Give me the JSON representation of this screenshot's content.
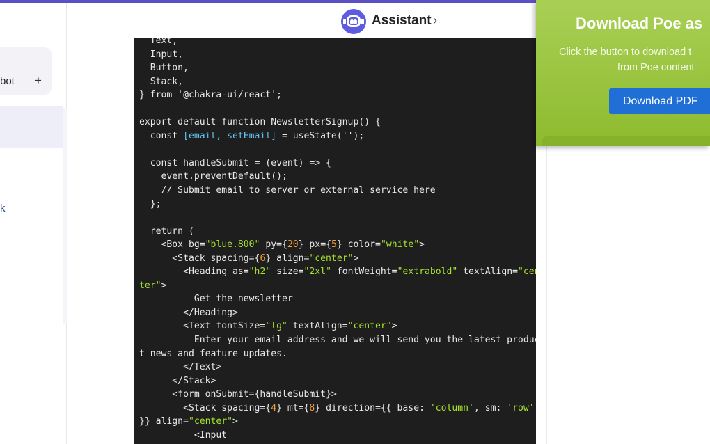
{
  "sidebar": {
    "new_chat_label": "bot",
    "plus_symbol": "+",
    "link_fragment": "k"
  },
  "header": {
    "bot_name": "Assistant",
    "chevron": "›"
  },
  "code_block": {
    "lines": [
      [
        {
          "t": "  Text,"
        }
      ],
      [
        {
          "t": "  Input,"
        }
      ],
      [
        {
          "t": "  Button,"
        }
      ],
      [
        {
          "t": "  Stack,"
        }
      ],
      [
        {
          "t": "} from '@chakra-ui/react';"
        }
      ],
      [
        {
          "t": ""
        }
      ],
      [
        {
          "t": "export default function NewsletterSignup() {"
        }
      ],
      [
        {
          "t": "  const "
        },
        {
          "t": "[email, setEmail]",
          "c": "var"
        },
        {
          "t": " = useState('');"
        }
      ],
      [
        {
          "t": ""
        }
      ],
      [
        {
          "t": "  const handleSubmit = (event) => {"
        }
      ],
      [
        {
          "t": "    event.preventDefault();"
        }
      ],
      [
        {
          "t": "    // Submit email to server or external service here"
        }
      ],
      [
        {
          "t": "  };"
        }
      ],
      [
        {
          "t": ""
        }
      ],
      [
        {
          "t": "  return ("
        }
      ],
      [
        {
          "t": "    <Box bg="
        },
        {
          "t": "\"blue.800\"",
          "c": "str"
        },
        {
          "t": " py={"
        },
        {
          "t": "20",
          "c": "num"
        },
        {
          "t": "} px={"
        },
        {
          "t": "5",
          "c": "num"
        },
        {
          "t": "} color="
        },
        {
          "t": "\"white\"",
          "c": "str"
        },
        {
          "t": ">"
        }
      ],
      [
        {
          "t": "      <Stack spacing={"
        },
        {
          "t": "6",
          "c": "num"
        },
        {
          "t": "} align="
        },
        {
          "t": "\"center\"",
          "c": "str"
        },
        {
          "t": ">"
        }
      ],
      [
        {
          "t": "        <Heading as="
        },
        {
          "t": "\"h2\"",
          "c": "str"
        },
        {
          "t": " size="
        },
        {
          "t": "\"2xl\"",
          "c": "str"
        },
        {
          "t": " fontWeight="
        },
        {
          "t": "\"extrabold\"",
          "c": "str"
        },
        {
          "t": " textAlign="
        },
        {
          "t": "\"cen",
          "c": "str"
        }
      ],
      [
        {
          "t": "ter\"",
          "c": "str"
        },
        {
          "t": ">"
        }
      ],
      [
        {
          "t": "          Get the newsletter"
        }
      ],
      [
        {
          "t": "        </Heading>"
        }
      ],
      [
        {
          "t": "        <Text fontSize="
        },
        {
          "t": "\"lg\"",
          "c": "str"
        },
        {
          "t": " textAlign="
        },
        {
          "t": "\"center\"",
          "c": "str"
        },
        {
          "t": ">"
        }
      ],
      [
        {
          "t": "          Enter your email address and we will send you the latest produc"
        }
      ],
      [
        {
          "t": "t news and feature updates."
        }
      ],
      [
        {
          "t": "        </Text>"
        }
      ],
      [
        {
          "t": "      </Stack>"
        }
      ],
      [
        {
          "t": "      <form onSubmit={handleSubmit}>"
        }
      ],
      [
        {
          "t": "        <Stack spacing={"
        },
        {
          "t": "4",
          "c": "num"
        },
        {
          "t": "} mt={"
        },
        {
          "t": "8",
          "c": "num"
        },
        {
          "t": "} direction={{ base: "
        },
        {
          "t": "'column'",
          "c": "str"
        },
        {
          "t": ", sm: "
        },
        {
          "t": "'row'",
          "c": "str"
        }
      ],
      [
        {
          "t": "}} align="
        },
        {
          "t": "\"center\"",
          "c": "str"
        },
        {
          "t": ">"
        }
      ],
      [
        {
          "t": "          <Input"
        }
      ]
    ]
  },
  "promo": {
    "title": "Download Poe as",
    "text_line1": "Click the button to download t",
    "text_line2": "from Poe content",
    "button_label": "Download PDF"
  },
  "colors": {
    "accent": "#5b4fc4",
    "bot_avatar": "#5d5cde",
    "code_bg": "#1e1e1e",
    "promo_green": "#9cc63e",
    "promo_button": "#1f6fd6"
  }
}
